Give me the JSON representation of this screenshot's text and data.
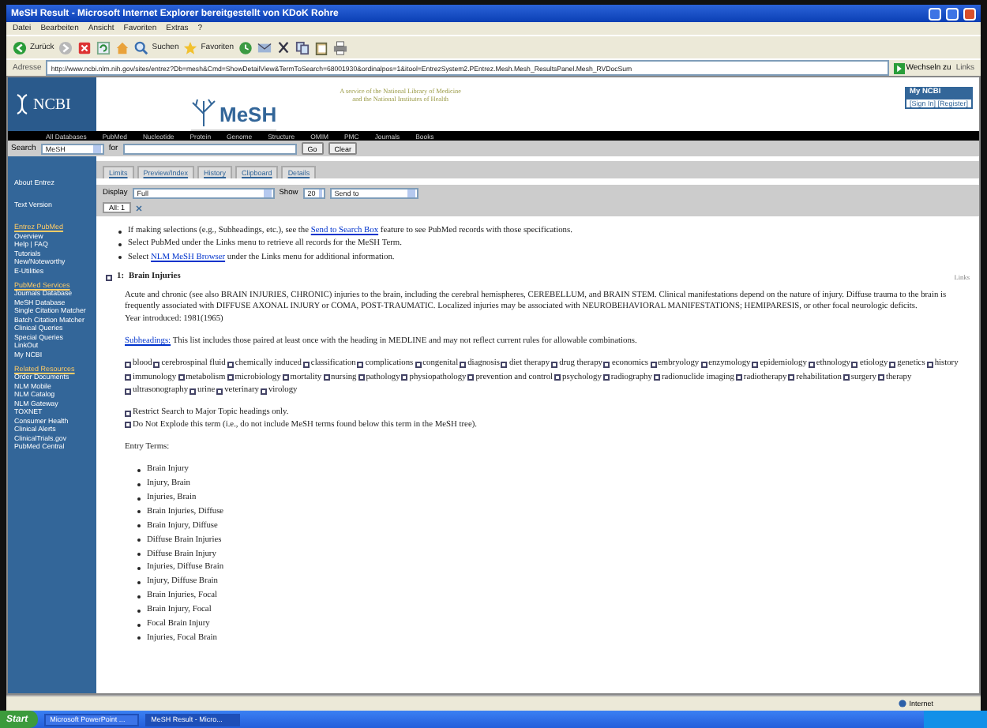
{
  "window": {
    "title": "MeSH Result - Microsoft Internet Explorer bereitgestellt von KDoK Rohre"
  },
  "menu": [
    "Datei",
    "Bearbeiten",
    "Ansicht",
    "Favoriten",
    "Extras",
    "?"
  ],
  "toolbar": [
    {
      "kind": "back",
      "label": "Zurück"
    },
    {
      "kind": "forward"
    },
    {
      "kind": "stop"
    },
    {
      "kind": "refresh"
    },
    {
      "kind": "home"
    },
    {
      "kind": "search",
      "label": "Suchen"
    },
    {
      "kind": "favorites",
      "label": "Favoriten"
    },
    {
      "kind": "history"
    },
    {
      "kind": "mail"
    },
    {
      "kind": "cut"
    },
    {
      "kind": "copy"
    },
    {
      "kind": "paste"
    },
    {
      "kind": "print"
    }
  ],
  "address": {
    "label": "Adresse",
    "url": "http://www.ncbi.nlm.nih.gov/sites/entrez?Db=mesh&Cmd=ShowDetailView&TermToSearch=68001930&ordinalpos=1&itool=EntrezSystem2.PEntrez.Mesh.Mesh_ResultsPanel.Mesh_RVDocSum",
    "go": "Wechseln zu",
    "links": "Links"
  },
  "header": {
    "logo": "NCBI",
    "product": "MeSH",
    "tagline": "A service of the National Library of Medicine",
    "tagline2": "and the National Institutes of Health",
    "my_ncbi": "My NCBI",
    "sign_in": "[Sign In] [Register]"
  },
  "nav": [
    "All Databases",
    "PubMed",
    "Nucleotide",
    "Protein",
    "Genome",
    "Structure",
    "OMIM",
    "PMC",
    "Journals",
    "Books"
  ],
  "search": {
    "label": "Search",
    "database": "MeSH",
    "for": "for",
    "go": "Go",
    "clear": "Clear"
  },
  "tabs": [
    {
      "label": "Limits",
      "selected": false
    },
    {
      "label": "Preview/Index",
      "selected": false
    },
    {
      "label": "History",
      "selected": false
    },
    {
      "label": "Clipboard",
      "selected": false
    },
    {
      "label": "Details",
      "selected": false
    }
  ],
  "sidebar": [
    {
      "items": [
        "About Entrez"
      ]
    },
    {
      "items": [
        "Text Version"
      ]
    },
    {
      "title": "Entrez PubMed",
      "items": [
        "Overview",
        "Help | FAQ",
        "Tutorials",
        "New/Noteworthy",
        "E-Utilities"
      ]
    },
    {
      "title": "PubMed Services",
      "items": [
        "Journals Database",
        "MeSH Database",
        "Single Citation Matcher",
        "Batch Citation Matcher",
        "Clinical Queries",
        "Special Queries",
        "LinkOut",
        "My NCBI"
      ]
    },
    {
      "title": "Related Resources",
      "items": [
        "Order Documents",
        "NLM Mobile",
        "NLM Catalog",
        "NLM Gateway",
        "TOXNET",
        "Consumer Health",
        "Clinical Alerts",
        "ClinicalTrials.gov",
        "PubMed Central"
      ]
    }
  ],
  "display": {
    "label": "Display",
    "value": "Full",
    "show_label": "Show",
    "show_value": "20",
    "send_to": "Send to"
  },
  "result_tabs": [
    {
      "label": "All: 1",
      "selected": true
    }
  ],
  "tips": [
    {
      "before": "If making selections (e.g., Subheadings, etc.), see the ",
      "link": "Send to Search Box",
      "after": " feature to see PubMed records with those specifications."
    },
    {
      "before": "Select PubMed under the Links menu to retrieve all records for the MeSH Term."
    },
    {
      "before": "Select ",
      "link": "NLM MeSH Browser",
      "after": " under the Links menu for additional information."
    }
  ],
  "record": {
    "checked": false,
    "number": "1:",
    "title": "Brain Injuries",
    "links": "Links",
    "scope_note": "Acute and chronic (see also BRAIN INJURIES, CHRONIC) injuries to the brain, including the cerebral hemispheres, CEREBELLUM, and BRAIN STEM. Clinical manifestations depend on the nature of injury. Diffuse trauma to the brain is frequently associated with DIFFUSE AXONAL INJURY or COMA, POST-TRAUMATIC. Localized injuries may be associated with NEUROBEHAVIORAL MANIFESTATIONS; HEMIPARESIS, or other focal neurologic deficits.",
    "year": "Year introduced: 1981(1965)",
    "subheadings_link": "Subheadings:",
    "subheadings_note": "This list includes those paired at least once with the heading in MEDLINE and may not reflect current rules for allowable combinations.",
    "subheadings": [
      {
        "label": "blood",
        "checked": false
      },
      {
        "label": "cerebrospinal fluid",
        "checked": false
      },
      {
        "label": "chemically induced",
        "checked": false
      },
      {
        "label": "classification",
        "checked": false
      },
      {
        "label": "complications",
        "checked": false
      },
      {
        "label": "congenital",
        "checked": false
      },
      {
        "label": "diagnosis",
        "checked": false
      },
      {
        "label": "diet therapy",
        "checked": false
      },
      {
        "label": "drug therapy",
        "checked": false
      },
      {
        "label": "economics",
        "checked": false
      },
      {
        "label": "embryology",
        "checked": false
      },
      {
        "label": "enzymology",
        "checked": false
      },
      {
        "label": "epidemiology",
        "checked": false
      },
      {
        "label": "ethnology",
        "checked": false
      },
      {
        "label": "etiology",
        "checked": false
      },
      {
        "label": "genetics",
        "checked": false
      },
      {
        "label": "history",
        "checked": false
      },
      {
        "label": "immunology",
        "checked": false
      },
      {
        "label": "metabolism",
        "checked": false
      },
      {
        "label": "microbiology",
        "checked": false
      },
      {
        "label": "mortality",
        "checked": false
      },
      {
        "label": "nursing",
        "checked": false
      },
      {
        "label": "pathology",
        "checked": false
      },
      {
        "label": "physiopathology",
        "checked": false
      },
      {
        "label": "prevention and control",
        "checked": false
      },
      {
        "label": "psychology",
        "checked": false
      },
      {
        "label": "radiography",
        "checked": false
      },
      {
        "label": "radionuclide imaging",
        "checked": false
      },
      {
        "label": "radiotherapy",
        "checked": false
      },
      {
        "label": "rehabilitation",
        "checked": false
      },
      {
        "label": "surgery",
        "checked": false
      },
      {
        "label": "therapy",
        "checked": false
      },
      {
        "label": "ultrasonography",
        "checked": false
      },
      {
        "label": "urine",
        "checked": false
      },
      {
        "label": "veterinary",
        "checked": false
      },
      {
        "label": "virology",
        "checked": false
      }
    ],
    "options": [
      {
        "label": "Restrict Search to Major Topic headings only.",
        "checked": false
      },
      {
        "label": "Do Not Explode this term (i.e., do not include MeSH terms found below this term in the MeSH tree).",
        "checked": false
      }
    ],
    "entry_terms_title": "Entry Terms:",
    "entry_terms": [
      "Brain Injury",
      "Injury, Brain",
      "Injuries, Brain",
      "Brain Injuries, Diffuse",
      "Brain Injury, Diffuse",
      "Diffuse Brain Injuries",
      "Diffuse Brain Injury",
      "Injuries, Diffuse Brain",
      "Injury, Diffuse Brain",
      "Brain Injuries, Focal",
      "Brain Injury, Focal",
      "Focal Brain Injury",
      "Injuries, Focal Brain"
    ]
  },
  "status_bar": {
    "zone": "Internet"
  },
  "taskbar": {
    "start": "Start",
    "tasks": [
      {
        "label": "Microsoft PowerPoint ...",
        "selected": false
      },
      {
        "label": "MeSH Result - Micro...",
        "selected": true
      }
    ]
  }
}
